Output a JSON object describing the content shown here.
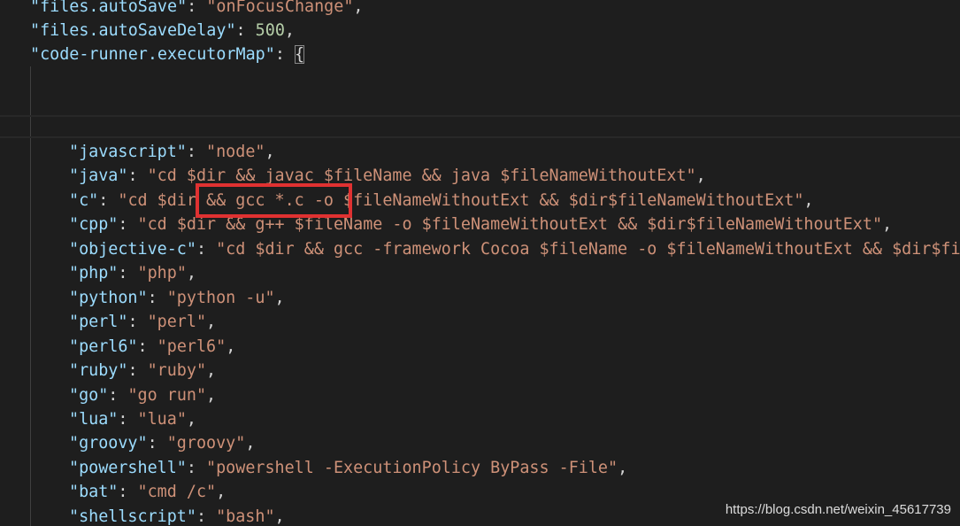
{
  "header_lines": [
    {
      "key": "\"files.autoSave\"",
      "sep": ": ",
      "value": "\"onFocusChange\"",
      "tail": ","
    },
    {
      "key": "\"files.autoSaveDelay\"",
      "sep": ": ",
      "value": "500",
      "tail": ","
    },
    {
      "key": "\"code-runner.executorMap\"",
      "sep": ": ",
      "value": "{",
      "tail": ""
    }
  ],
  "executor_map": [
    {
      "key": "\"javascript\"",
      "value": "\"node\"",
      "tail": ","
    },
    {
      "key": "\"java\"",
      "value": "\"cd $dir && javac $fileName && java $fileNameWithoutExt\"",
      "tail": ","
    },
    {
      "key": "\"c\"",
      "value": "\"cd $dir && gcc *.c -o $fileNameWithoutExt && $dir$fileNameWithoutExt\"",
      "tail": ","
    },
    {
      "key": "\"cpp\"",
      "value": "\"cd $dir && g++ $fileName -o $fileNameWithoutExt && $dir$fileNameWithoutExt\"",
      "tail": ","
    },
    {
      "key": "\"objective-c\"",
      "value": "\"cd $dir && gcc -framework Cocoa $fileName -o $fileNameWithoutExt && $dir$fil",
      "tail": ""
    },
    {
      "key": "\"php\"",
      "value": "\"php\"",
      "tail": ","
    },
    {
      "key": "\"python\"",
      "value": "\"python -u\"",
      "tail": ","
    },
    {
      "key": "\"perl\"",
      "value": "\"perl\"",
      "tail": ","
    },
    {
      "key": "\"perl6\"",
      "value": "\"perl6\"",
      "tail": ","
    },
    {
      "key": "\"ruby\"",
      "value": "\"ruby\"",
      "tail": ","
    },
    {
      "key": "\"go\"",
      "value": "\"go run\"",
      "tail": ","
    },
    {
      "key": "\"lua\"",
      "value": "\"lua\"",
      "tail": ","
    },
    {
      "key": "\"groovy\"",
      "value": "\"groovy\"",
      "tail": ","
    },
    {
      "key": "\"powershell\"",
      "value": "\"powershell -ExecutionPolicy ByPass -File\"",
      "tail": ","
    },
    {
      "key": "\"bat\"",
      "value": "\"cmd /c\"",
      "tail": ","
    },
    {
      "key": "\"shellscript\"",
      "value": "\"bash\"",
      "tail": ","
    }
  ],
  "annotation": {
    "highlighted_text": "&& gcc *.c -o",
    "color": "#e03131"
  },
  "watermark": "https://blog.csdn.net/weixin_45617739",
  "colors": {
    "background": "#1e1e1e",
    "key": "#9cdcfe",
    "string": "#ce9178",
    "number": "#b5cea8",
    "punctuation": "#d4d4d4"
  }
}
